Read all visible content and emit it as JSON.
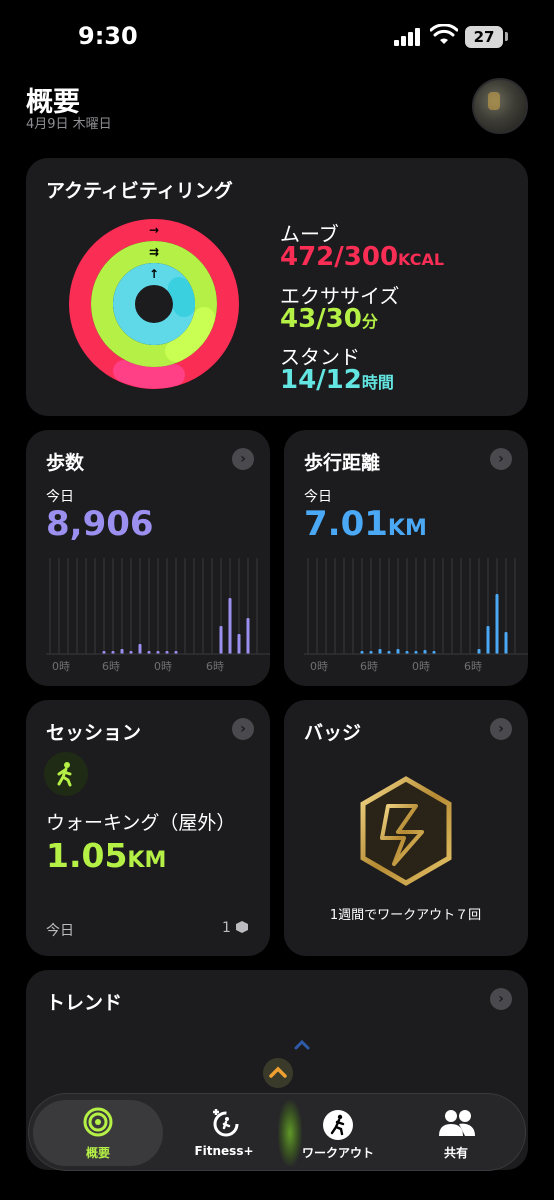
{
  "status_bar": {
    "time": "9:30",
    "battery": "27"
  },
  "header": {
    "title": "概要",
    "date": "4月9日 木曜日"
  },
  "activity_rings": {
    "title": "アクティビティリング",
    "move": {
      "label": "ムーブ",
      "value": "472/300",
      "unit": "KCAL",
      "color": "#fa2d55",
      "progress": 1.57
    },
    "exercise": {
      "label": "エクササイズ",
      "value": "43/30",
      "unit": "分",
      "color": "#b5f046",
      "progress": 1.43
    },
    "stand": {
      "label": "スタンド",
      "value": "14/12",
      "unit": "時間",
      "color": "#63e6e2",
      "progress": 1.17
    }
  },
  "steps": {
    "title": "歩数",
    "period": "今日",
    "value": "8,906",
    "unit": "",
    "color": "#9b8ff0",
    "axis_labels": [
      "0時",
      "6時",
      "0時",
      "6時"
    ]
  },
  "distance": {
    "title": "歩行距離",
    "period": "今日",
    "value": "7.01",
    "unit": "KM",
    "color": "#4aa8f5",
    "axis_labels": [
      "0時",
      "6時",
      "0時",
      "6時"
    ]
  },
  "session": {
    "title": "セッション",
    "workout_name": "ウォーキング（屋外）",
    "distance": "1.05",
    "unit": "KM",
    "period": "今日",
    "count": "1"
  },
  "badges": {
    "title": "バッジ",
    "caption": "1週間でワークアウト７回"
  },
  "trends": {
    "title": "トレンド"
  },
  "tab_bar": {
    "tabs": [
      {
        "label": "概要",
        "icon": "rings-icon",
        "active": true
      },
      {
        "label": "Fitness+",
        "icon": "fitness-plus-icon",
        "active": false
      },
      {
        "label": "ワークアウト",
        "icon": "workout-icon",
        "active": false
      },
      {
        "label": "共有",
        "icon": "sharing-icon",
        "active": false
      }
    ]
  }
}
